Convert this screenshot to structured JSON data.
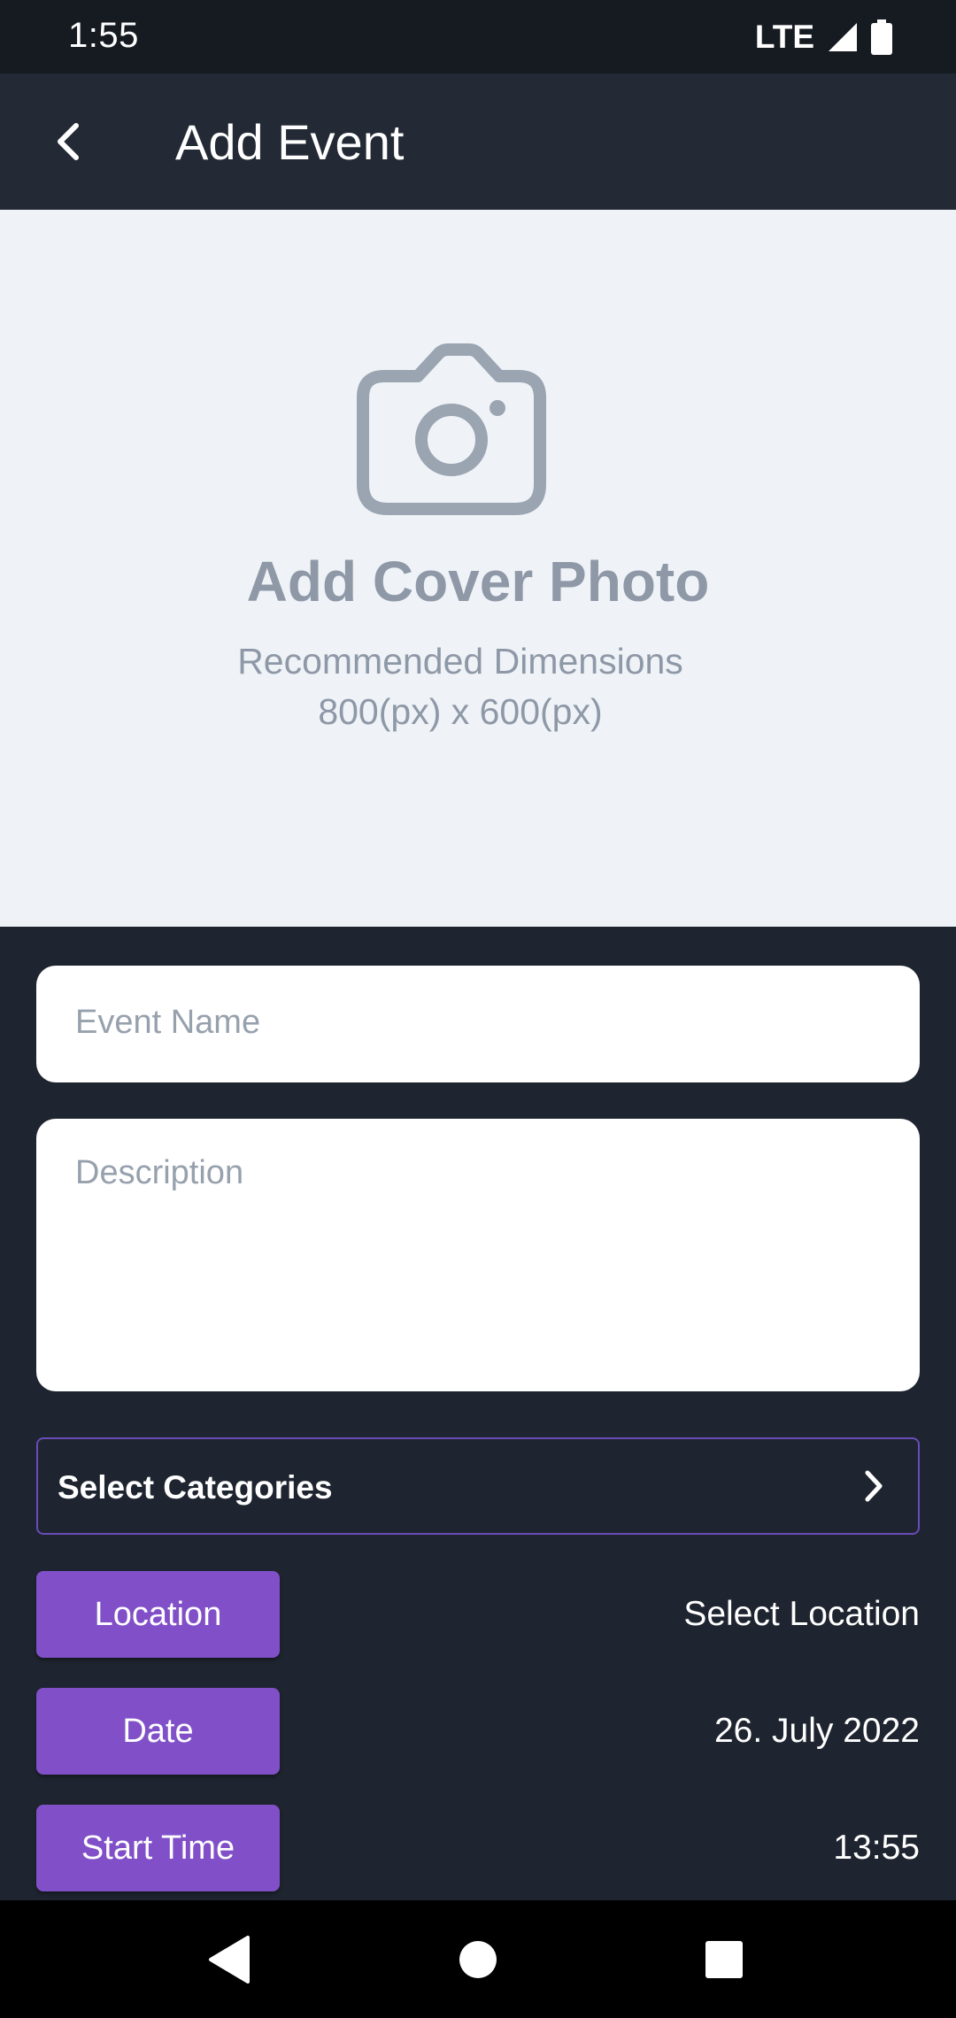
{
  "status_bar": {
    "time": "1:55",
    "network": "LTE"
  },
  "app_bar": {
    "title": "Add Event",
    "back_icon": "arrow-back-icon"
  },
  "cover": {
    "icon": "camera-icon",
    "title": "Add Cover Photo",
    "subtitle_line1": "Recommended Dimensions",
    "subtitle_line2": "800(px) x 600(px)"
  },
  "form": {
    "event_name_placeholder": "Event Name",
    "description_placeholder": "Description",
    "categories_label": "Select Categories",
    "location_label": "Location",
    "location_value": "Select Location",
    "date_label": "Date",
    "date_value": "26. July 2022",
    "start_time_label": "Start Time",
    "start_time_value": "13:55"
  },
  "colors": {
    "accent": "#8150c9",
    "background": "#1f2530",
    "app_bar": "#232a35",
    "cover_bg": "#eff3f8",
    "muted_text": "#8e98a6"
  }
}
